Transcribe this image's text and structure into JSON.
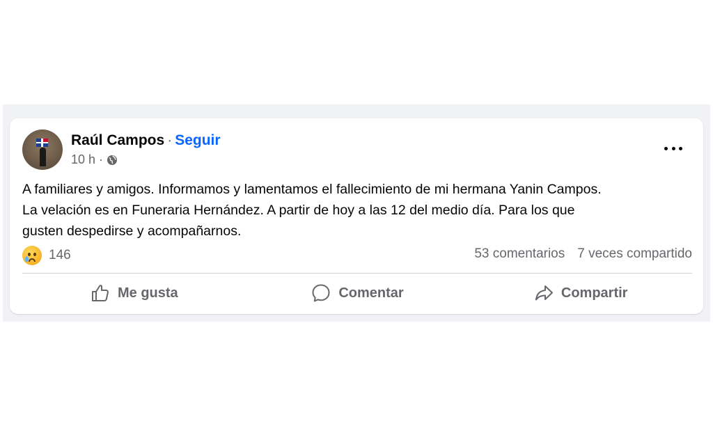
{
  "post": {
    "author": "Raúl Campos",
    "separator": "·",
    "follow_label": "Seguir",
    "time": "10 h",
    "time_separator": "·",
    "audience_icon": "globe-icon",
    "menu_icon": "more-options-icon",
    "text": "A familiares y amigos. Informamos y lamentamos el fallecimiento de mi hermana Yanin Campos.\nLa velación  es en Funeraria Hernández. A partir de hoy a las 12 del medio día. Para los que\ngusten despedirse y acompañarnos."
  },
  "reactions": {
    "icon": "sad-reaction-icon",
    "count": "146"
  },
  "stats": {
    "comments": "53 comentarios",
    "shares": "7 veces compartido"
  },
  "actions": {
    "like": {
      "label": "Me gusta",
      "icon": "thumbs-up-icon"
    },
    "comment": {
      "label": "Comentar",
      "icon": "comment-bubble-icon"
    },
    "share": {
      "label": "Compartir",
      "icon": "share-arrow-icon"
    }
  },
  "colors": {
    "link": "#0866ff",
    "secondary_text": "#65676b",
    "background_band": "#f0f2f5"
  }
}
